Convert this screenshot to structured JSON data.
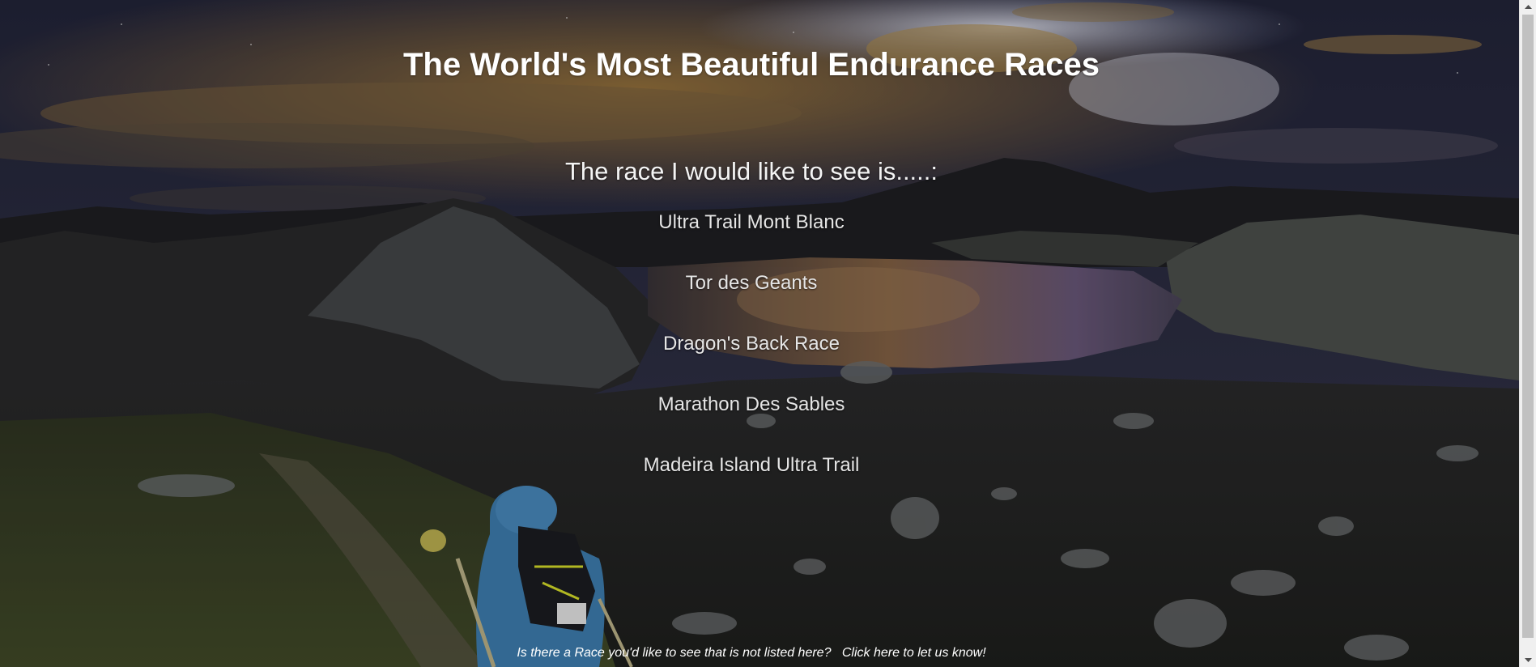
{
  "header": {
    "title": "The World's Most Beautiful Endurance Races"
  },
  "intro": {
    "prompt": "The race I would like to see is.....:"
  },
  "races": [
    {
      "label": "Ultra Trail Mont Blanc"
    },
    {
      "label": "Tor des Geants"
    },
    {
      "label": "Dragon's Back Race"
    },
    {
      "label": "Marathon Des Sables"
    },
    {
      "label": "Madeira Island Ultra Trail"
    }
  ],
  "footer": {
    "question": "Is there a Race you'd like to see that is not listed here?",
    "link_label": "Click here to let us know!"
  },
  "background": {
    "sky_color": "#2b2a3d",
    "accent_cloud_color": "#a4803f",
    "lake_color": "#6a4d52",
    "jacket_color": "#3f7fb3"
  },
  "icons": {
    "scroll_up": "triangle-up",
    "scroll_down": "triangle-down"
  }
}
